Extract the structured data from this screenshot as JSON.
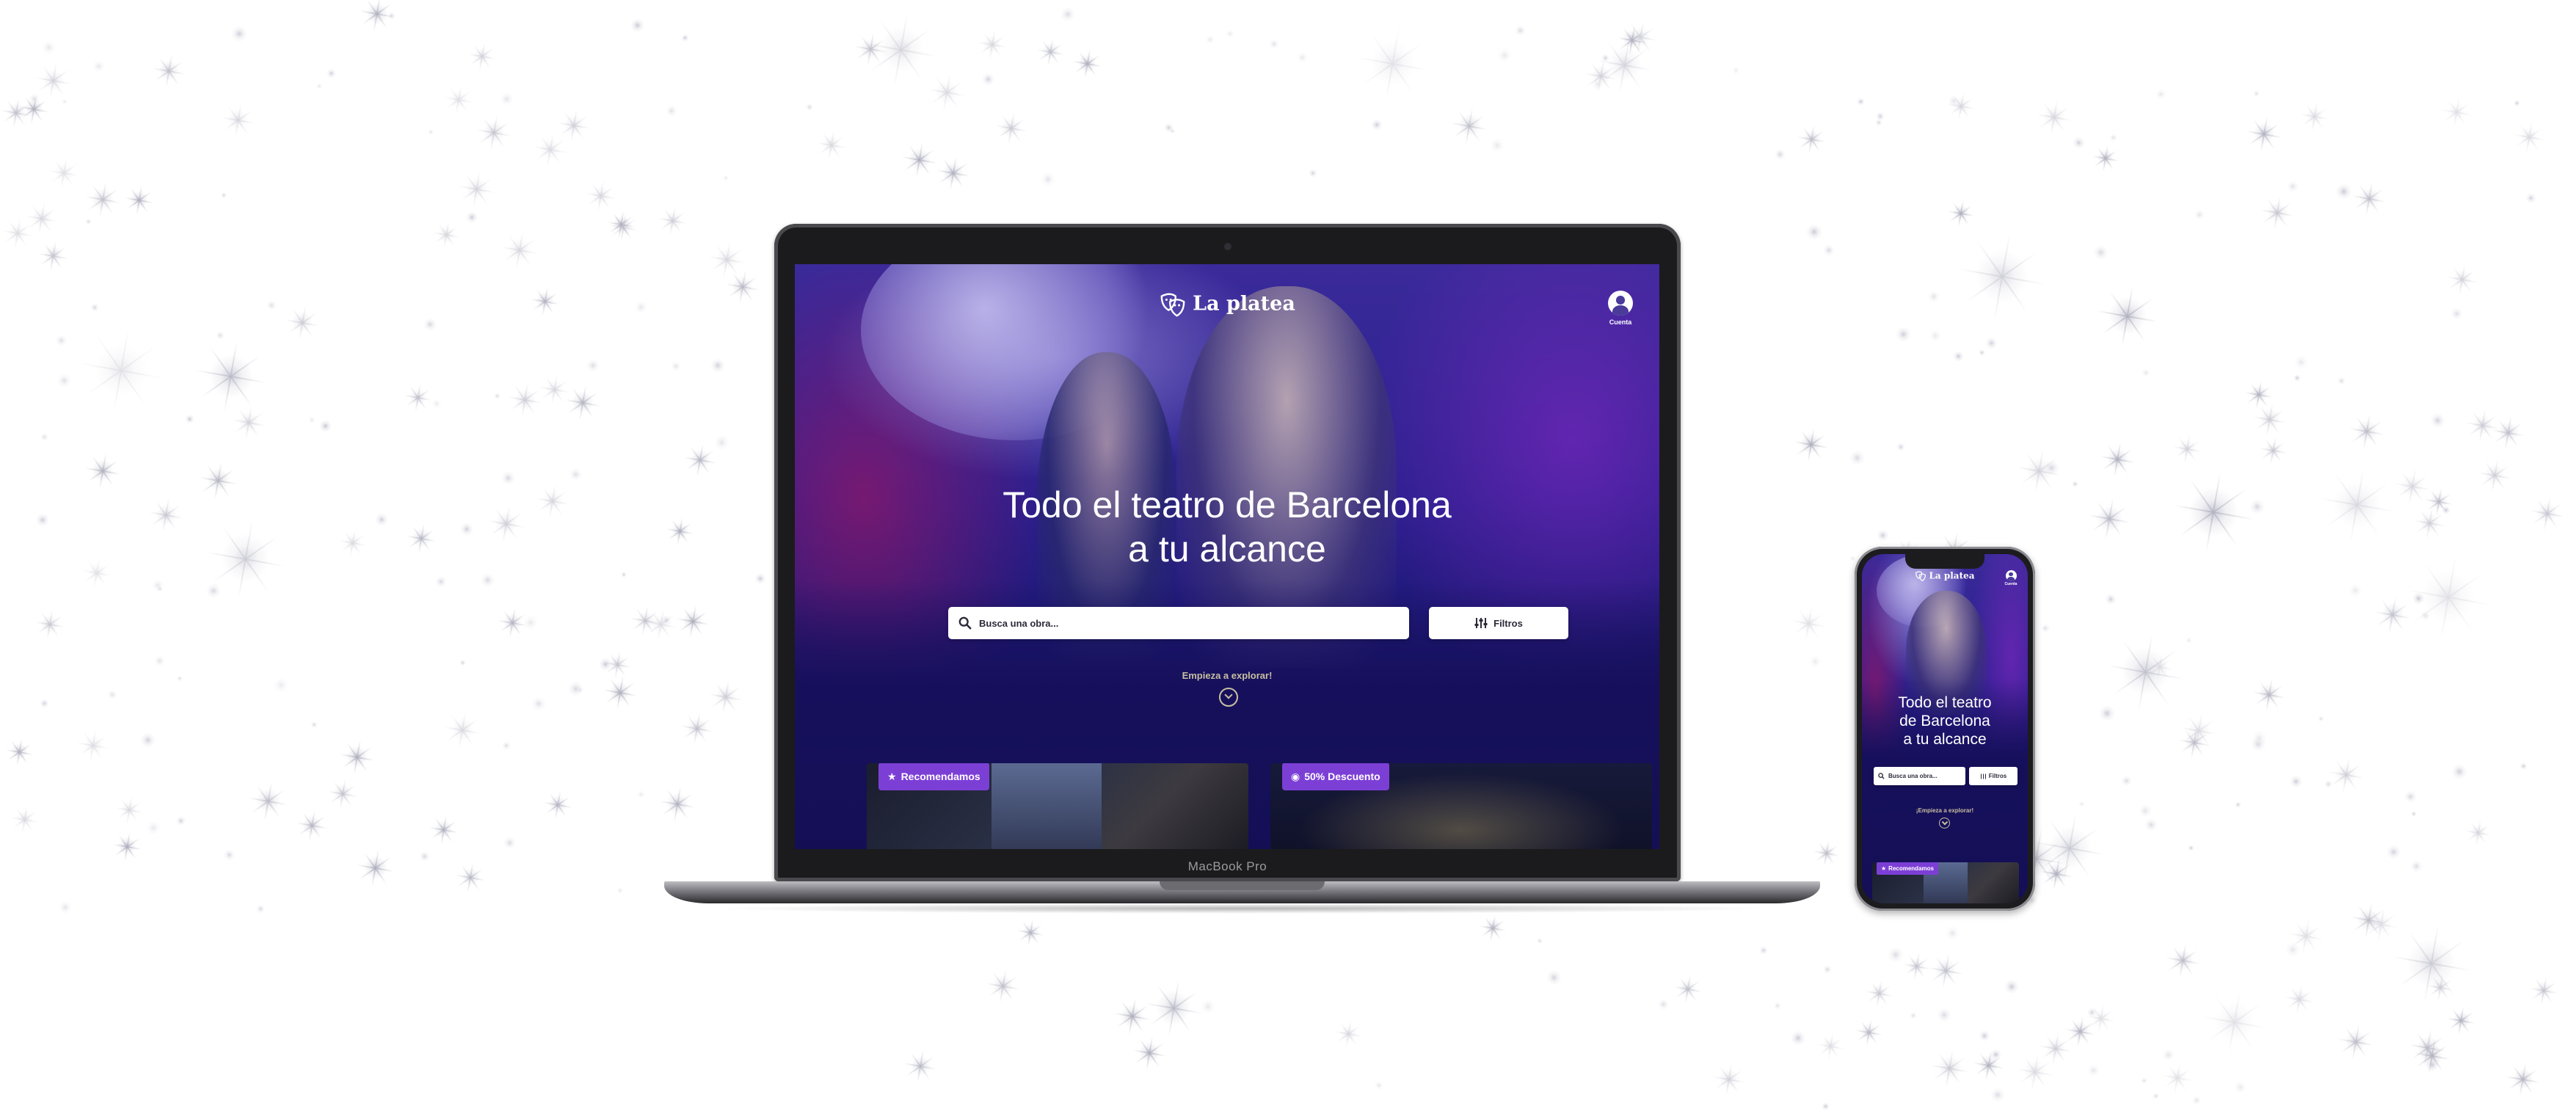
{
  "brand": {
    "name": "La platea",
    "logo_icon": "theatre-masks-icon"
  },
  "account": {
    "label": "Cuenta",
    "icon": "user-circle-icon"
  },
  "hero": {
    "headline_line1": "Todo el teatro de Barcelona",
    "headline_line2": "a tu alcance",
    "mobile_line1": "Todo el teatro",
    "mobile_line2": "de Barcelona",
    "mobile_line3": "a tu alcance"
  },
  "search": {
    "placeholder": "Busca una obra...",
    "icon": "search-icon"
  },
  "filters": {
    "label": "Filtros",
    "icon": "sliders-icon"
  },
  "explore": {
    "label": "Empieza a explorar!",
    "mobile_label": "¡Empieza a explorar!",
    "icon": "chevron-down-icon"
  },
  "cards": [
    {
      "badge": "Recomendamos",
      "badge_icon": "star-icon"
    },
    {
      "badge": "50% Descuento",
      "badge_icon": "discount-icon"
    }
  ],
  "device": {
    "laptop_label": "MacBook Pro"
  },
  "colors": {
    "badge": "#7c3fd6",
    "hero_deep": "#15105a",
    "hero_mid": "#2a1f8e",
    "explore": "#c9bfa0"
  }
}
